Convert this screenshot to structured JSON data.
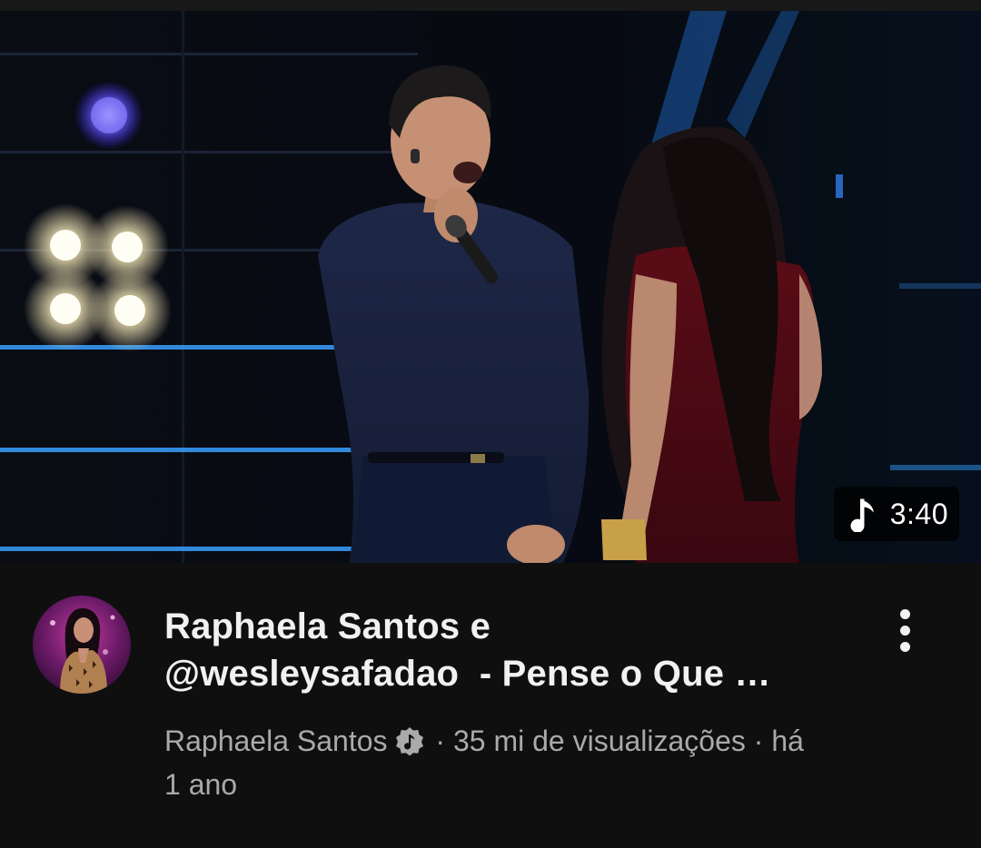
{
  "video": {
    "duration": "3:40",
    "duration_icon": "music-note-icon",
    "title_line1": "Raphaela Santos e",
    "title_line2": "@wesleysafadao  - Pense o Que …",
    "channel_name": "Raphaela Santos",
    "channel_badge_icon": "verified-music-icon",
    "separator": "·",
    "views": "35 mi de visualizações",
    "age_part1": "há",
    "age_part2": "1 ano",
    "menu_icon": "more-vert-icon"
  },
  "colors": {
    "background": "#0f0f0f",
    "title": "#f1f1f1",
    "meta": "#aaaaaa",
    "stage_light_blue": "#3aa0ff"
  }
}
